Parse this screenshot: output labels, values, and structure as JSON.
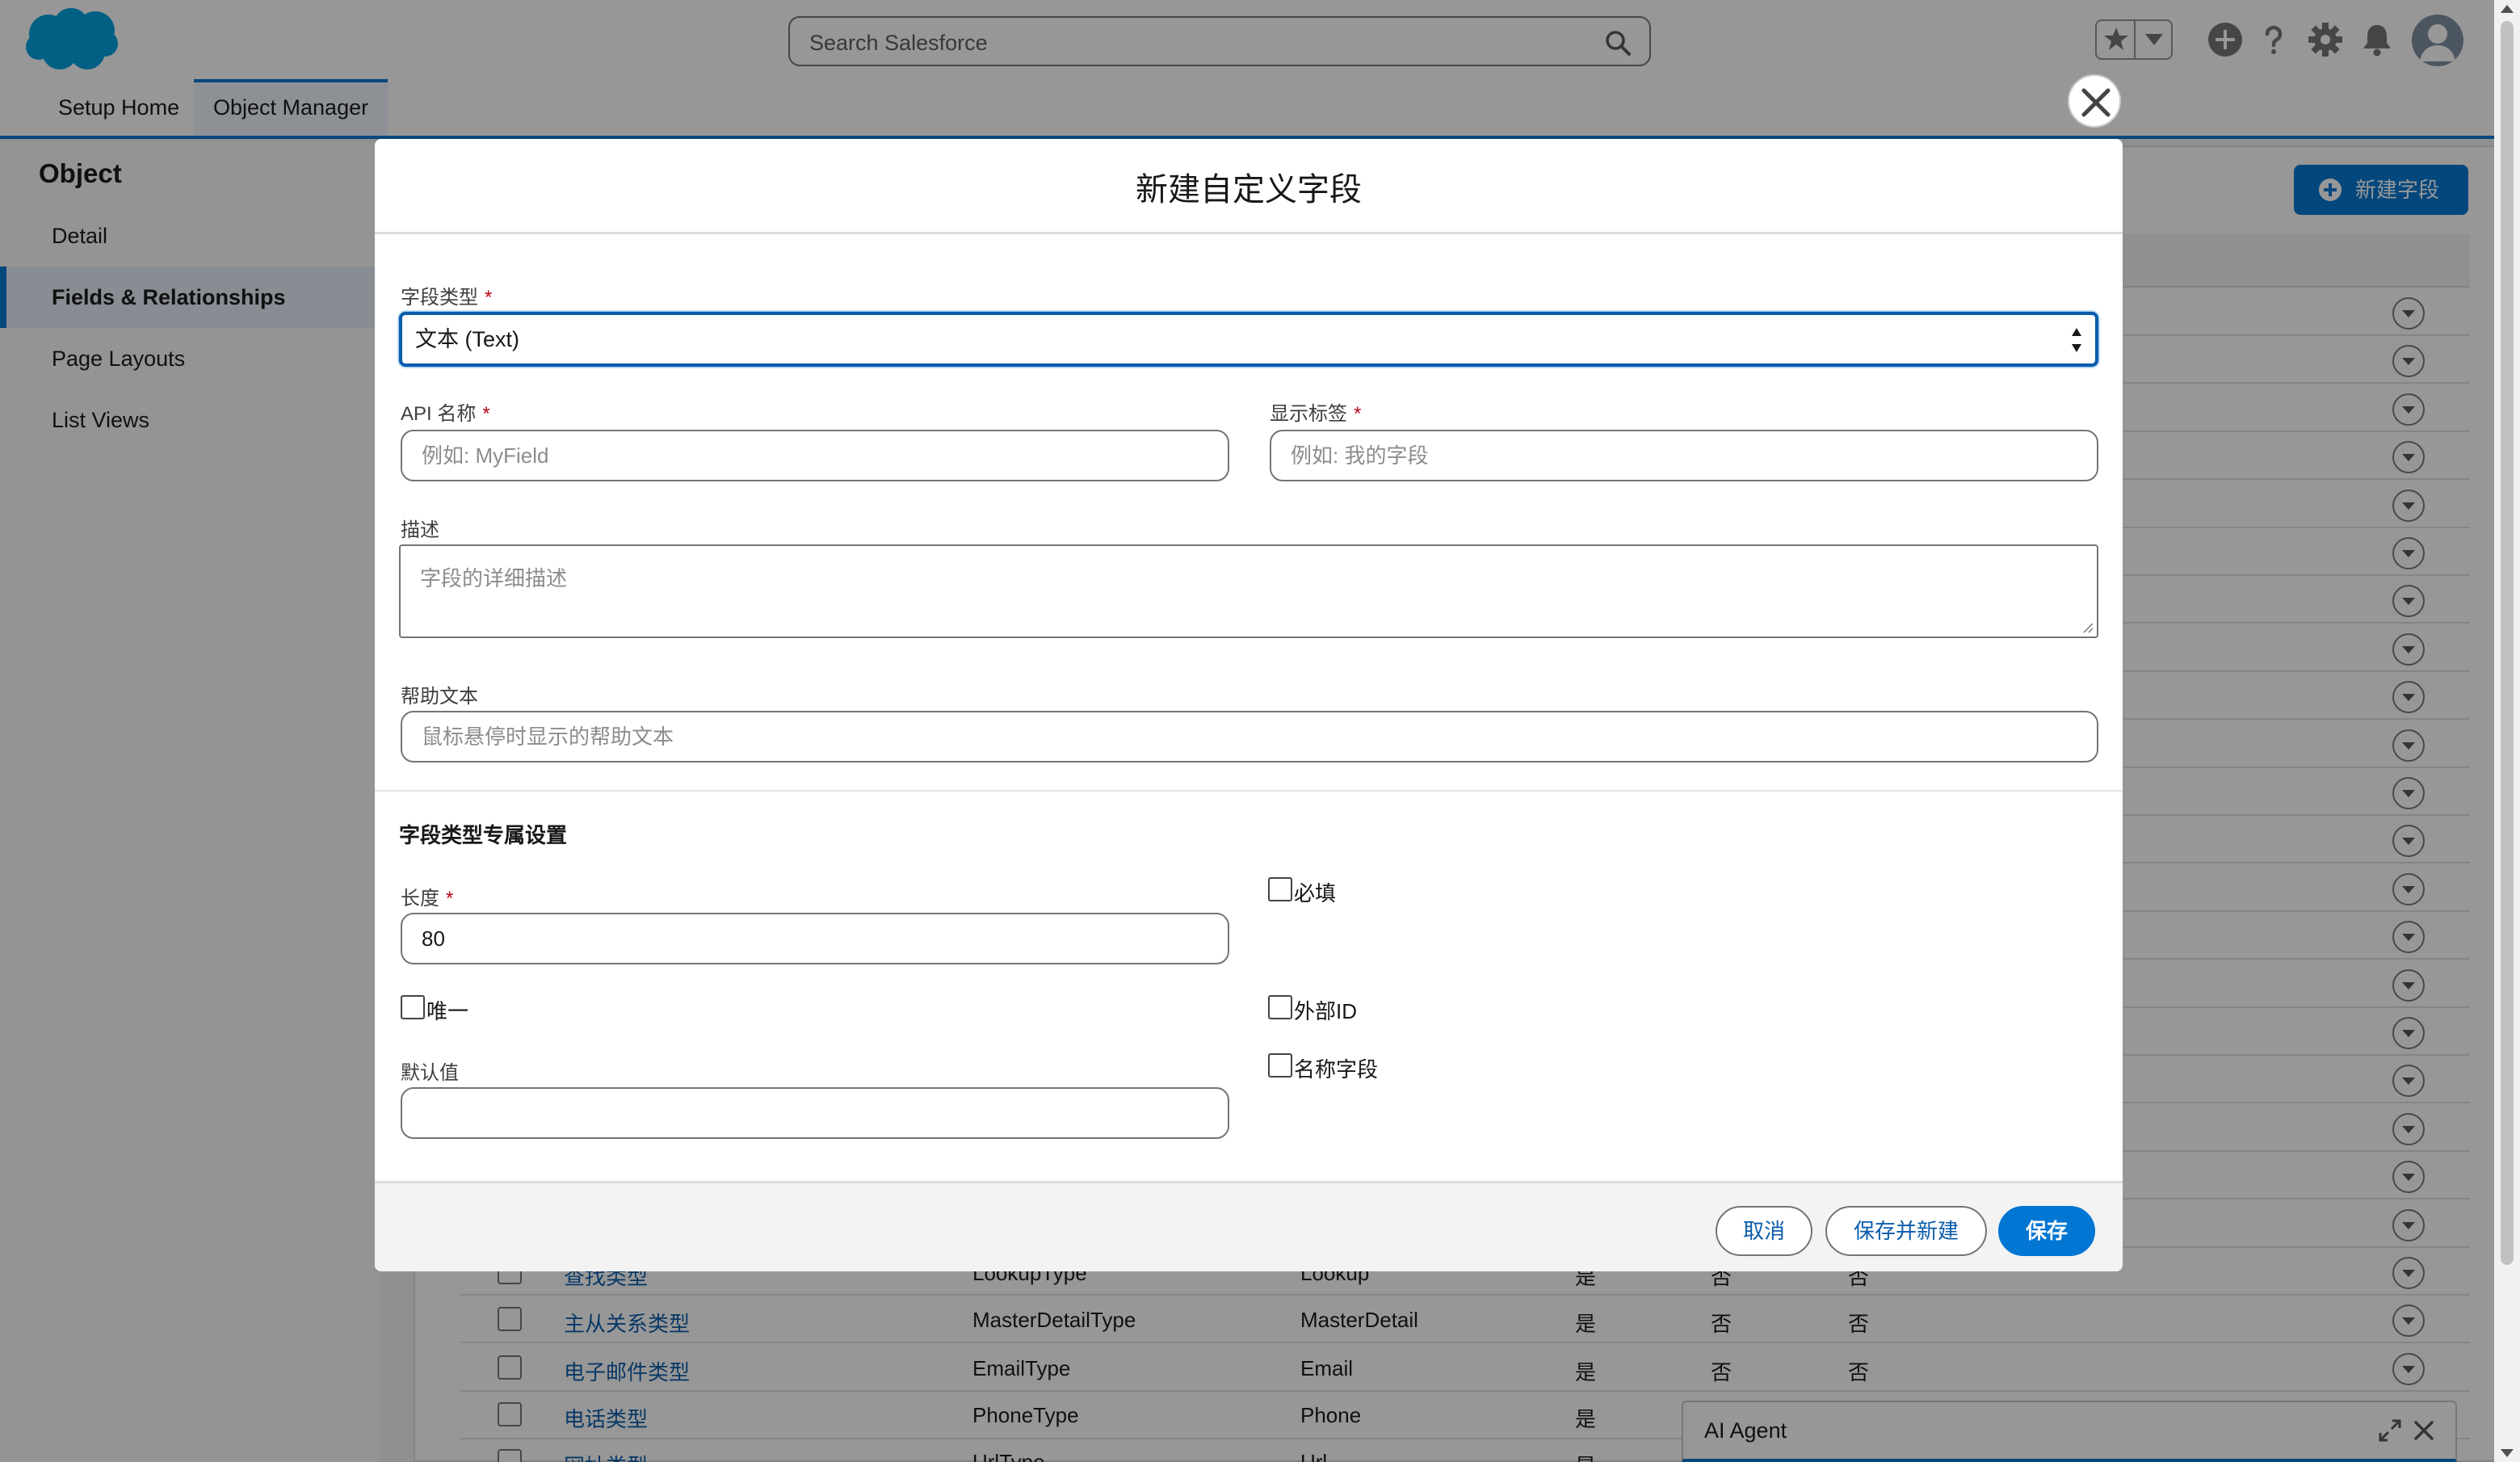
{
  "header": {
    "search_placeholder": "Search Salesforce"
  },
  "nav": {
    "tabs": [
      "Setup Home",
      "Object Manager"
    ],
    "active_tab": "Object Manager"
  },
  "sidebar": {
    "title": "Object",
    "items": [
      "Detail",
      "Fields & Relationships",
      "Page Layouts",
      "List Views"
    ],
    "active_item": "Fields & Relationships"
  },
  "content": {
    "new_field_button": "新建字段",
    "rows": [
      {
        "label": "查找类型",
        "api_name": "LookupType",
        "type": "Lookup",
        "c4": "是",
        "c5": "否",
        "c6": "否"
      },
      {
        "label": "主从关系类型",
        "api_name": "MasterDetailType",
        "type": "MasterDetail",
        "c4": "是",
        "c5": "否",
        "c6": "否"
      },
      {
        "label": "电子邮件类型",
        "api_name": "EmailType",
        "type": "Email",
        "c4": "是",
        "c5": "否",
        "c6": "否"
      },
      {
        "label": "电话类型",
        "api_name": "PhoneType",
        "type": "Phone",
        "c4": "是",
        "c5": "",
        "c6": ""
      },
      {
        "label": "网址类型",
        "api_name": "UrlType",
        "type": "Url",
        "c4": "是",
        "c5": "",
        "c6": ""
      }
    ]
  },
  "ai_agent": {
    "label": "AI Agent"
  },
  "modal": {
    "title": "新建自定义字段",
    "field_type": {
      "label": "字段类型",
      "value": "文本 (Text)"
    },
    "api_name": {
      "label": "API 名称",
      "placeholder": "例如: MyField"
    },
    "display_label": {
      "label": "显示标签",
      "placeholder": "例如: 我的字段"
    },
    "description": {
      "label": "描述",
      "placeholder": "字段的详细描述"
    },
    "help_text": {
      "label": "帮助文本",
      "placeholder": "鼠标悬停时显示的帮助文本"
    },
    "section_title": "字段类型专属设置",
    "length": {
      "label": "长度",
      "value": "80"
    },
    "default_value": {
      "label": "默认值",
      "value": ""
    },
    "checkboxes": {
      "required": {
        "label": "必填",
        "checked": false
      },
      "unique": {
        "label": "唯一",
        "checked": false
      },
      "external_id": {
        "label": "外部ID",
        "checked": false
      },
      "name_field": {
        "label": "名称字段",
        "checked": false
      }
    },
    "buttons": {
      "cancel": "取消",
      "save_and_new": "保存并新建",
      "save": "保存"
    }
  },
  "colors": {
    "brand": "#0176d3",
    "link": "#0b5cab",
    "required": "#ba0517",
    "logo": "#00a1e0"
  }
}
